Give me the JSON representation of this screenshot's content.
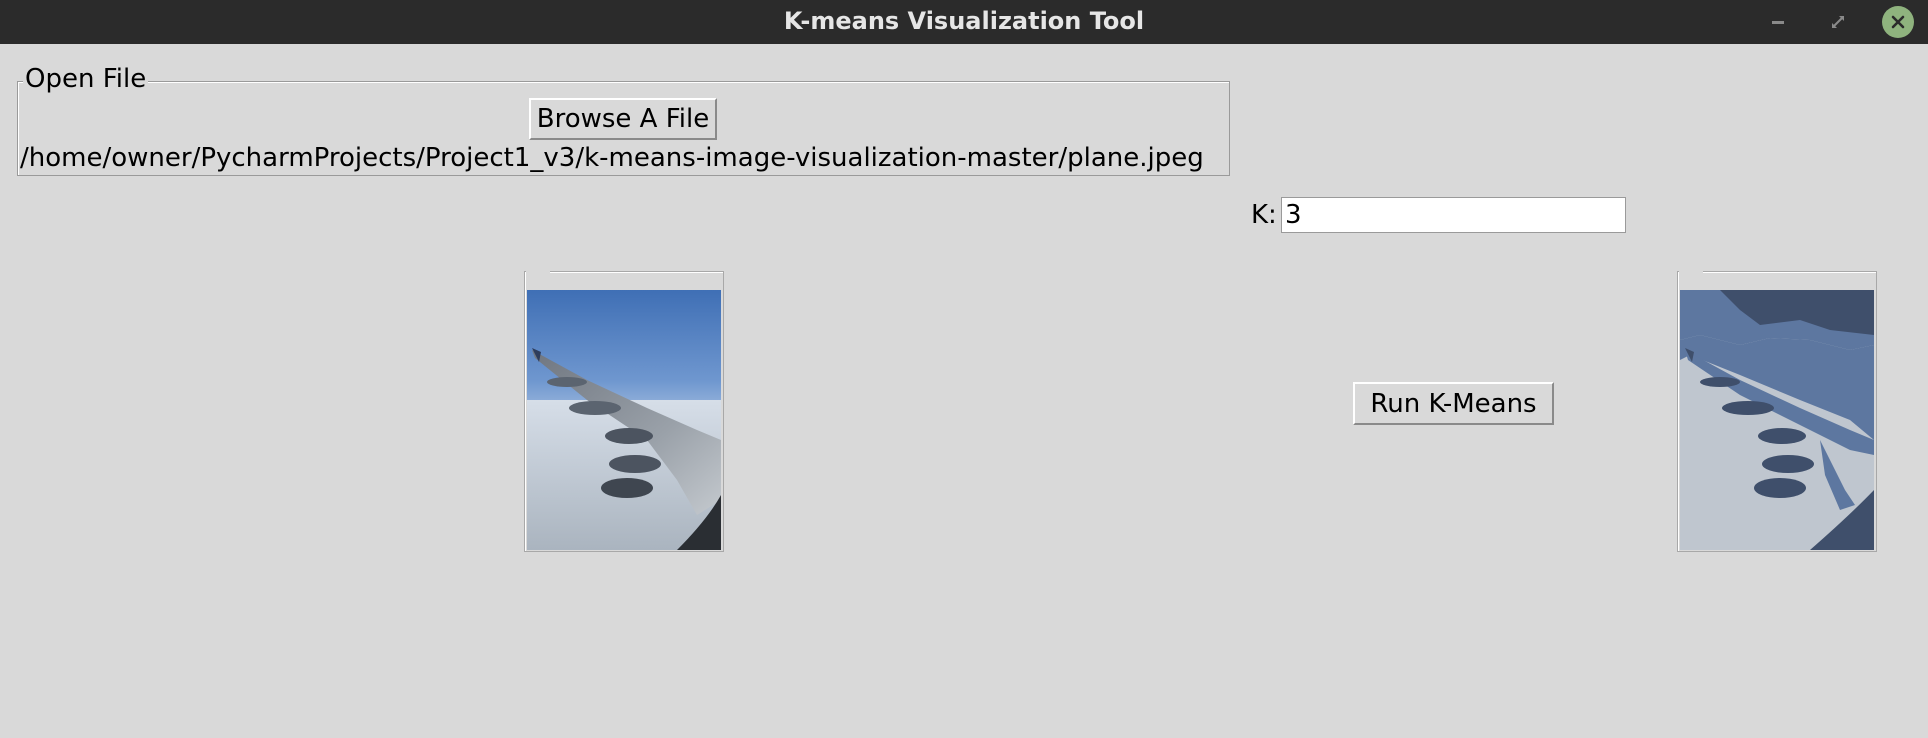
{
  "window": {
    "title": "K-means Visualization Tool",
    "controls": [
      "minimize-icon",
      "maximize-icon",
      "close-icon"
    ]
  },
  "file_group": {
    "legend": "Open File",
    "browse_label": "Browse A File",
    "path": "/home/owner/PycharmProjects/Project1_v3/k-means-image-visualization-master/plane.jpeg"
  },
  "kmeans": {
    "k_label": "K:",
    "k_value": "3",
    "run_label": "Run K-Means"
  },
  "images": {
    "original": "plane.jpeg",
    "result": "clustered-result"
  },
  "colors": {
    "titlebar": "#2b2b2b",
    "window_bg": "#d9d9d9",
    "close_button": "#8fb37e"
  }
}
